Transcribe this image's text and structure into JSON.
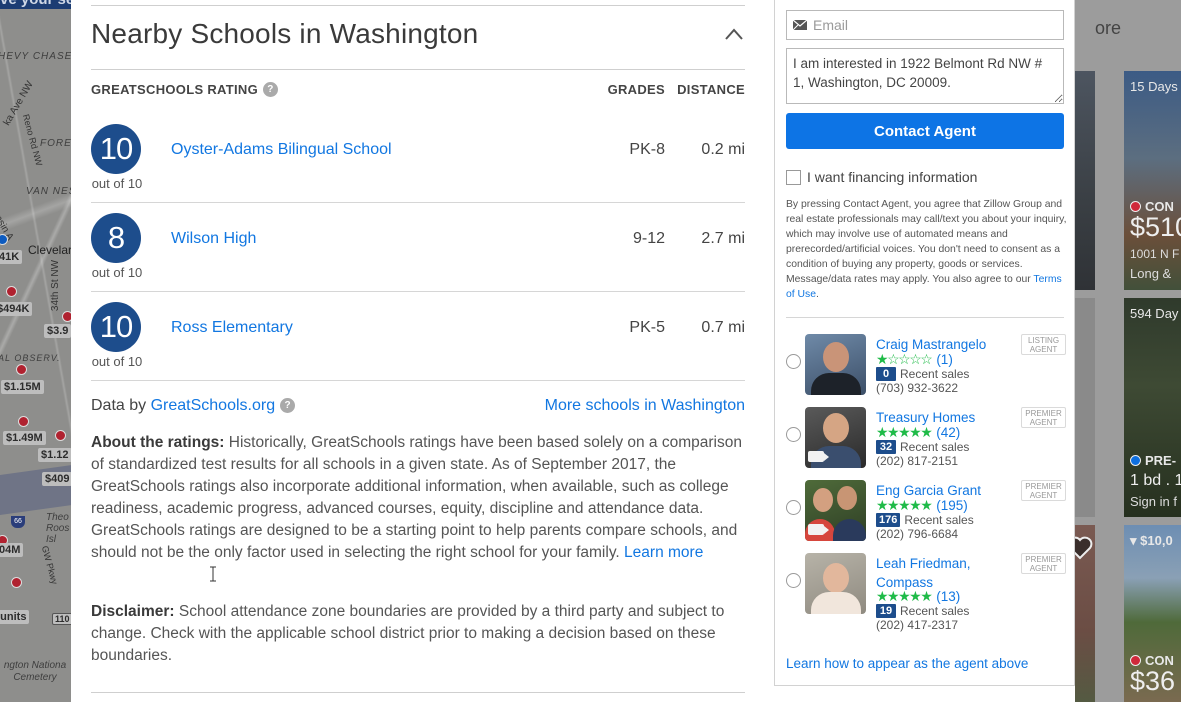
{
  "map": {
    "banner_text": "ve your se",
    "labels": [
      "HEVY CHASE",
      "FORES",
      "VAN NES",
      "Clevelar",
      "AL OBSERV.",
      "Theo Roos Isl",
      "GW Pkwy",
      "ngton Nationa Cemetery"
    ],
    "roads": [
      "ka Ave NW",
      "Reno Rd NW",
      "34th St NW",
      "onsin A"
    ],
    "prices": [
      "41K",
      "$494K",
      "$3.9",
      "$1.15M",
      "$1.49M",
      "$1.12",
      "$409",
      "04M",
      "s units"
    ],
    "route_shields": [
      "66",
      "110"
    ]
  },
  "schools": {
    "title": "Nearby Schools in Washington",
    "collapse_icon": "chevron-up-icon",
    "columns": {
      "rating": "GREATSCHOOLS RATING",
      "grades": "GRADES",
      "distance": "DISTANCE"
    },
    "help_glyph": "?",
    "list": [
      {
        "rating": "10",
        "out_of": "out of 10",
        "name": "Oyster-Adams Bilingual School",
        "grades": "PK-8",
        "distance": "0.2 mi"
      },
      {
        "rating": "8",
        "out_of": "out of 10",
        "name": "Wilson High",
        "grades": "9-12",
        "distance": "2.7 mi"
      },
      {
        "rating": "10",
        "out_of": "out of 10",
        "name": "Ross Elementary",
        "grades": "PK-5",
        "distance": "0.7 mi"
      }
    ],
    "data_by_prefix": "Data by ",
    "data_by_link": "GreatSchools.org",
    "more_schools_link": "More schools in Washington",
    "about_label": "About the ratings:",
    "about_text": " Historically, GreatSchools ratings have been based solely on a comparison of standardized test results for all schools in a given state. As of September 2017, the GreatSchools ratings also incorporate additional information, when available, such as college readiness, academic progress, advanced courses, equity, discipline and attendance data. GreatSchools ratings are designed to be a starting point to help parents compare schools, and should not be the only factor used in selecting the right school for your family. ",
    "learn_more_link": "Learn more",
    "disclaimer_label": "Disclaimer:",
    "disclaimer_text": " School attendance zone boundaries are provided by a third party and subject to change. Check with the applicable school district prior to making a decision based on these boundaries."
  },
  "contact": {
    "email_placeholder": "Email",
    "email_value": "",
    "message_value": "I am interested in 1922 Belmont Rd NW # 1, Washington, DC 20009.",
    "contact_button": "Contact Agent",
    "financing_label": "I want financing information",
    "financing_checked": false,
    "legal_text": "By pressing Contact Agent, you agree that Zillow Group and real estate professionals may call/text you about your inquiry, which may involve use of automated means and prerecorded/artificial voices. You don't need to consent as a condition of buying any property, goods or services. Message/data rates may apply. You also agree to our ",
    "terms_link": "Terms of Use",
    "legal_end": ".",
    "agents": [
      {
        "name": "Craig Mastrangelo",
        "rating_stars": 1,
        "max_stars": 5,
        "reviews": "(1)",
        "recent_sales": "0",
        "recent_sales_label": "Recent sales",
        "phone": "(703) 932-3622",
        "type_line1": "LISTING",
        "type_line2": "AGENT",
        "has_video": false
      },
      {
        "name": "Treasury Homes",
        "rating_stars": 5,
        "max_stars": 5,
        "reviews": "(42)",
        "recent_sales": "32",
        "recent_sales_label": "Recent sales",
        "phone": "(202) 817-2151",
        "type_line1": "PREMIER",
        "type_line2": "AGENT",
        "has_video": true
      },
      {
        "name": "Eng Garcia Grant",
        "rating_stars": 5,
        "max_stars": 5,
        "reviews": "(195)",
        "recent_sales": "176",
        "recent_sales_label": "Recent sales",
        "phone": "(202) 796-6684",
        "type_line1": "PREMIER",
        "type_line2": "AGENT",
        "has_video": true
      },
      {
        "name": "Leah Friedman, Compass",
        "rating_stars": 5,
        "max_stars": 5,
        "reviews": "(13)",
        "recent_sales": "19",
        "recent_sales_label": "Recent sales",
        "phone": "(202) 417-2317",
        "type_line1": "PREMIER",
        "type_line2": "AGENT",
        "has_video": false
      }
    ],
    "learn_appear_link": "Learn how to appear as the agent above"
  },
  "listings": {
    "more_text": "ore",
    "cards": [
      {
        "days": "15 Days",
        "status": "CON",
        "status_color": "#d0283a",
        "price": "$510",
        "line1": "1001 N F",
        "line2": "Long &"
      },
      {
        "days": "594 Day",
        "status": "PRE-",
        "status_color": "#0d6fe0",
        "price": "",
        "line1": "1 bd . 1",
        "line2": "Sign in f"
      },
      {
        "days": "$10,0",
        "status": "CON",
        "status_color": "#d0283a",
        "price": "$36",
        "line1": "",
        "line2": ""
      }
    ]
  },
  "colors": {
    "accent_blue": "#0d74e5",
    "link_blue": "#1277e1",
    "rating_navy": "#1d4d8c",
    "star_green": "#1fbb48"
  }
}
